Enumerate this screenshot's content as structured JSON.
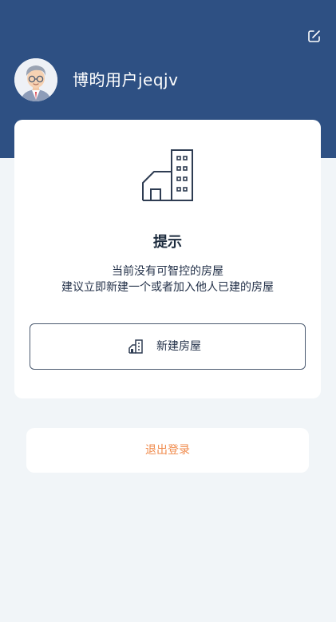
{
  "header": {
    "username": "博昀用户jeqjv",
    "edit_icon": "edit-icon",
    "avatar_icon": "avatar-icon"
  },
  "card": {
    "icon": "house-building-icon",
    "tip_title": "提示",
    "tip_line1": "当前没有可智控的房屋",
    "tip_line2": "建议立即新建一个或者加入他人已建的房屋",
    "new_house_label": "新建房屋",
    "new_house_icon": "house-icon"
  },
  "logout": {
    "label": "退出登录"
  },
  "colors": {
    "header_bg": "#2e5083",
    "page_bg": "#f1f5f8",
    "logout_text": "#f08a4b"
  }
}
